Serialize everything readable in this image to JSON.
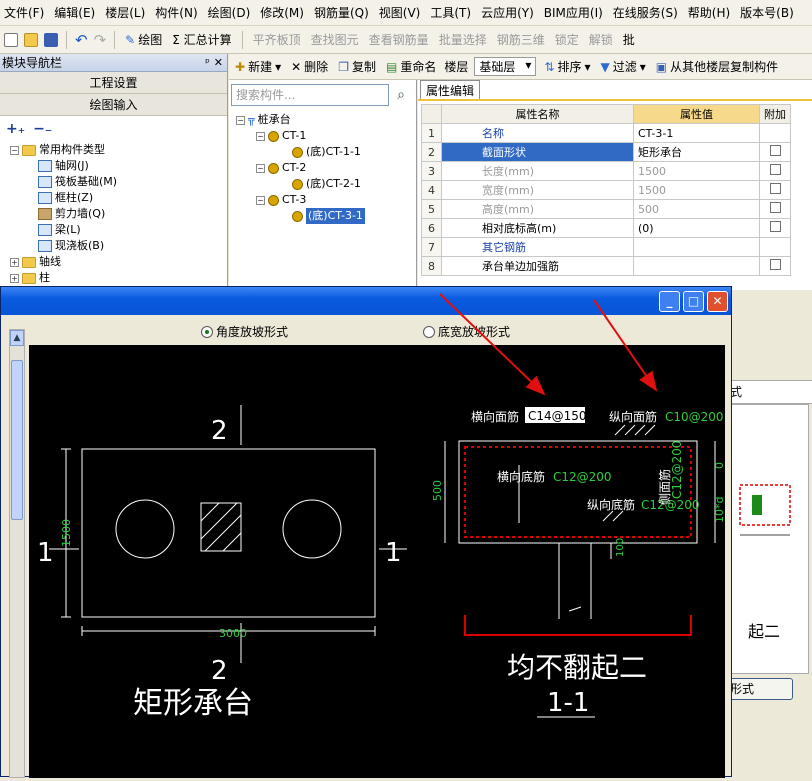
{
  "menu": [
    "文件(F)",
    "编辑(E)",
    "楼层(L)",
    "构件(N)",
    "绘图(D)",
    "修改(M)",
    "钢筋量(Q)",
    "视图(V)",
    "工具(T)",
    "云应用(Y)",
    "BIM应用(I)",
    "在线服务(S)",
    "帮助(H)",
    "版本号(B)"
  ],
  "toolbar": {
    "draw": "绘图",
    "sum": "Σ 汇总计算",
    "flat": "平齐板顶",
    "find": "查找图元",
    "view_rebar": "查看钢筋量",
    "batch": "批量选择",
    "rebar3d": "钢筋三维",
    "lock": "锁定",
    "unlock": "解锁",
    "batch2": "批"
  },
  "nav": {
    "title": "模块导航栏",
    "pin": "ᵖ",
    "close": "✕",
    "sec1": "工程设置",
    "sec2": "绘图输入",
    "tree_root": "常用构件类型",
    "items": [
      "轴网(J)",
      "筏板基础(M)",
      "框柱(Z)",
      "剪力墙(Q)",
      "梁(L)",
      "现浇板(B)"
    ],
    "folder2": "轴线",
    "folder3": "柱"
  },
  "comp_toolbar": {
    "new": "新建",
    "delete": "删除",
    "copy": "复制",
    "rename": "重命名",
    "floor_label": "楼层",
    "floor_value": "基础层",
    "sort": "排序",
    "filter": "过滤",
    "copy_from": "从其他楼层复制构件"
  },
  "search": {
    "placeholder": "搜索构件..."
  },
  "comp_tree": {
    "root": "桩承台",
    "groups": [
      {
        "name": "CT-1",
        "child": "(底)CT-1-1"
      },
      {
        "name": "CT-2",
        "child": "(底)CT-2-1"
      },
      {
        "name": "CT-3",
        "child": "(底)CT-3-1"
      }
    ]
  },
  "prop": {
    "tab": "属性编辑",
    "headers": [
      "属性名称",
      "属性值",
      "附加"
    ],
    "rows": [
      {
        "n": "1",
        "name": "名称",
        "value": "CT-3-1"
      },
      {
        "n": "2",
        "name": "截面形状",
        "value": "矩形承台"
      },
      {
        "n": "3",
        "name": "长度(mm)",
        "value": "1500"
      },
      {
        "n": "4",
        "name": "宽度(mm)",
        "value": "1500"
      },
      {
        "n": "5",
        "name": "高度(mm)",
        "value": "500"
      },
      {
        "n": "6",
        "name": "相对底标高(m)",
        "value": "(0)"
      },
      {
        "n": "7",
        "name": "其它钢筋",
        "value": ""
      },
      {
        "n": "8",
        "name": "承台单边加强筋",
        "value": ""
      }
    ]
  },
  "dialog": {
    "opt1": "角度放坡形式",
    "opt2": "底宽放坡形式",
    "min": "_",
    "max": "□",
    "close": "✕"
  },
  "drawing": {
    "sec_top": "2",
    "sec_bottom": "2",
    "sec_left": "1",
    "sec_right": "1",
    "width_dim": "3000",
    "height_dim": "1500",
    "plan_title": "矩形承台",
    "top_transverse_label": "横向面筋",
    "top_transverse_value": "C14@150",
    "top_long_label": "纵向面筋",
    "top_long_value": "C10@200",
    "bottom_transverse_label": "横向底筋",
    "bottom_transverse_value": "C12@200",
    "bottom_long_label": "纵向底筋",
    "bottom_long_value": "C12@200",
    "side_label": "侧面筋",
    "side_value": "C12@200",
    "depth_dim": "500",
    "zero": "0",
    "ten_d": "10*d",
    "pile_dim": "100",
    "section_note": "均不翻起二",
    "section_title": "1-1"
  },
  "bgwin": {
    "title_frag": "式",
    "caption_frag": "起二",
    "button": "形式"
  }
}
